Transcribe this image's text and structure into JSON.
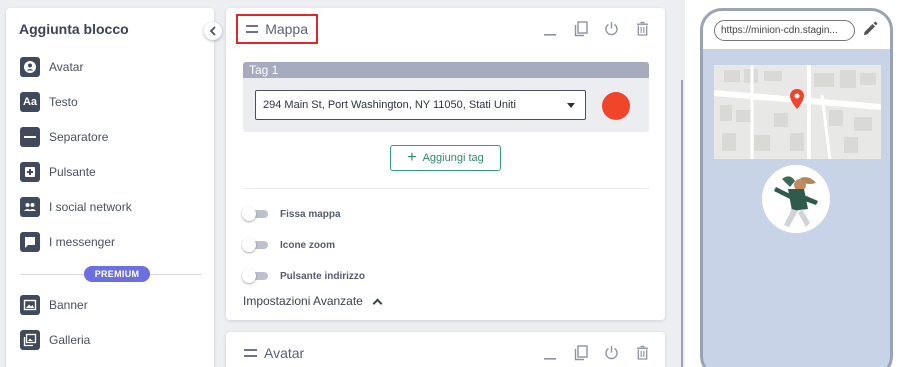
{
  "sidebar": {
    "title": "Aggiunta blocco",
    "items": [
      {
        "label": "Avatar",
        "icon": "avatar-icon"
      },
      {
        "label": "Testo",
        "icon": "text-icon"
      },
      {
        "label": "Separatore",
        "icon": "separator-icon"
      },
      {
        "label": "Pulsante",
        "icon": "button-plus-icon"
      },
      {
        "label": "I social network",
        "icon": "social-icon"
      },
      {
        "label": "I messenger",
        "icon": "messenger-icon"
      }
    ],
    "premium_label": "PREMIUM",
    "premium_items": [
      {
        "label": "Banner",
        "icon": "banner-icon"
      },
      {
        "label": "Galleria",
        "icon": "gallery-icon"
      }
    ]
  },
  "map_card": {
    "title": "Mappa",
    "tag": {
      "label": "Tag 1",
      "address": "294 Main St, Port Washington, NY 11050, Stati Uniti",
      "color": "#f0452a"
    },
    "add_tag_label": "Aggiungi tag",
    "toggles": [
      {
        "label": "Fissa mappa",
        "on": false
      },
      {
        "label": "Icone zoom",
        "on": false
      },
      {
        "label": "Pulsante indirizzo",
        "on": false
      }
    ],
    "advanced_label": "Impostazioni Avanzate"
  },
  "avatar_card": {
    "title": "Avatar"
  },
  "preview": {
    "url": "https://minion-cdn.stagin..."
  },
  "colors": {
    "accent_red": "#e0282c",
    "premium": "#6b6fe0",
    "add_tag_green": "#2e9e7e",
    "marker": "#f0452a"
  }
}
